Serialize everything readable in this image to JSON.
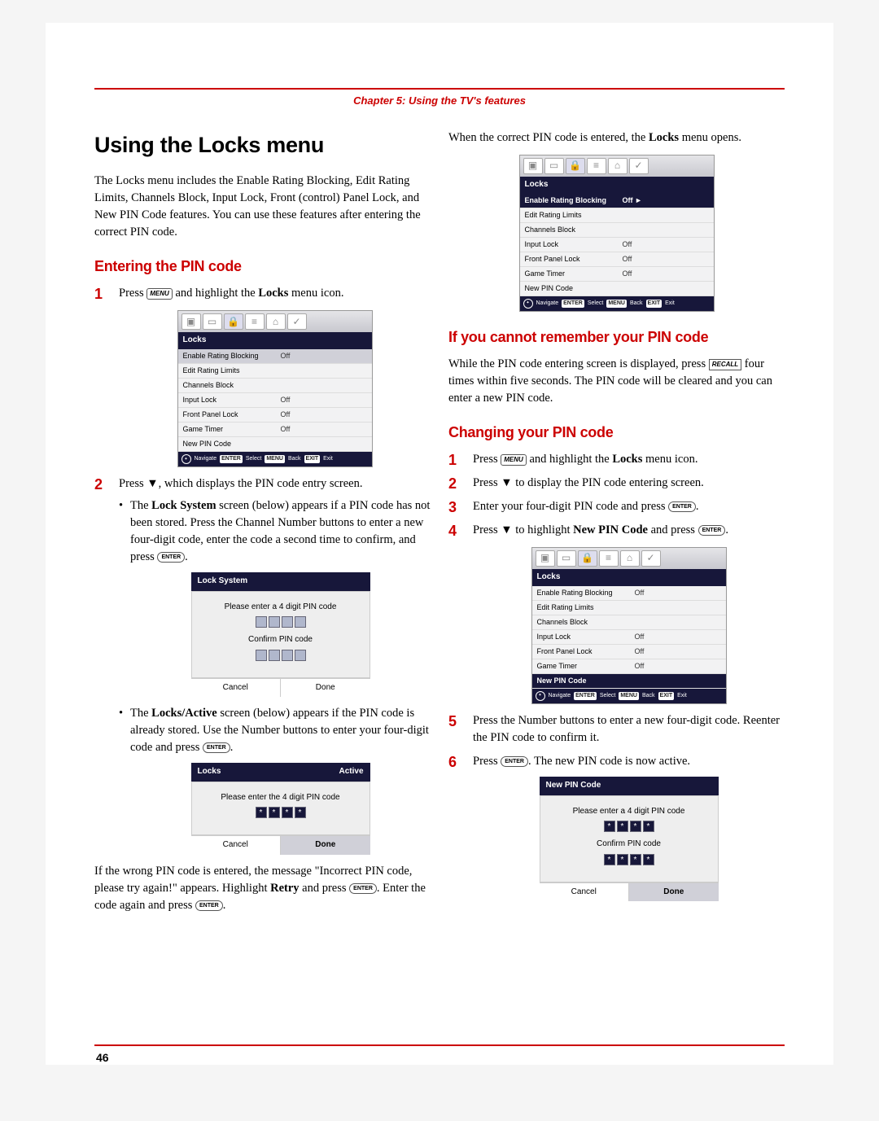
{
  "chapter": "Chapter 5: Using the TV's features",
  "page_number": "46",
  "left": {
    "h1": "Using the Locks menu",
    "intro": "The Locks menu includes the Enable Rating Blocking, Edit Rating Limits, Channels Block, Input Lock, Front (control) Panel Lock, and New PIN Code features. You can use these features after entering the correct PIN code.",
    "h2_entering": "Entering the PIN code",
    "step1_a": "Press ",
    "step1_b": " and highlight the ",
    "step1_c": "Locks",
    "step1_d": " menu icon.",
    "menu_key": "MENU",
    "step2_a": "Press ",
    "step2_arrow": "▼",
    "step2_b": ", which displays the PIN code entry screen.",
    "sub_lock_a": "The ",
    "sub_lock_b": "Lock System",
    "sub_lock_c": " screen (below) appears if a PIN code has not been stored. Press the Channel Number buttons to enter a new four-digit code, enter the code a second time to confirm, and press ",
    "enter_key": "ENTER",
    "period": ".",
    "sub_active_a": "The ",
    "sub_active_b": "Locks/Active",
    "sub_active_c": " screen (below) appears if the PIN code is already stored. Use the Number buttons to enter your four-digit code and press ",
    "wrong_a": "If the wrong PIN code is entered, the message \"Incorrect PIN code, please try again!\" appears. Highlight ",
    "wrong_b": "Retry",
    "wrong_c": " and press ",
    "wrong_d": ". Enter the code again and press "
  },
  "right": {
    "top_line_a": "When the correct PIN code is entered, the ",
    "top_line_b": "Locks",
    "top_line_c": " menu opens.",
    "h2_cannot": "If you cannot remember your PIN code",
    "cannot_a": "While the PIN code entering screen is displayed, press ",
    "recall_key": "RECALL",
    "cannot_b": " four times within five seconds. The PIN code will be cleared and you can enter a new PIN code.",
    "h2_changing": "Changing your PIN code",
    "c1_a": "Press ",
    "c1_b": " and highlight the ",
    "c1_c": "Locks",
    "c1_d": " menu icon.",
    "c2_a": "Press ",
    "c2_arrow": "▼",
    "c2_b": " to display the PIN code entering screen.",
    "c3_a": "Enter your four-digit PIN code and press ",
    "c4_a": "Press ",
    "c4_b": " to highlight ",
    "c4_c": "New PIN Code",
    "c4_d": " and press ",
    "c5": "Press the Number buttons to enter a new four-digit code. Reenter the PIN code to confirm it.",
    "c6_a": "Press ",
    "c6_b": ". The new PIN code is now active."
  },
  "osd": {
    "locks_title": "Locks",
    "rows": {
      "r1_label": "Enable Rating Blocking",
      "r1_val": "Off",
      "r2_label": "Edit Rating Limits",
      "r3_label": "Channels Block",
      "r4_label": "Input Lock",
      "r4_val": "Off",
      "r5_label": "Front Panel Lock",
      "r5_val": "Off",
      "r6_label": "Game Timer",
      "r6_val": "Off",
      "r7_label": "New PIN Code"
    },
    "selected_suffix": "►",
    "navigate": "Navigate",
    "select": "Select",
    "back": "Back",
    "exit": "Exit",
    "enter_tag": "ENTER",
    "menu_tag": "MENU",
    "exit_tag": "EXIT",
    "lock_system_title": "Lock System",
    "please_enter": "Please enter a 4 digit PIN code",
    "confirm": "Confirm PIN code",
    "cancel": "Cancel",
    "done": "Done",
    "active_title_left": "Locks",
    "active_title_right": "Active",
    "please_enter_the": "Please enter the 4 digit PIN code",
    "new_pin_title": "New PIN Code",
    "dot": "*"
  }
}
